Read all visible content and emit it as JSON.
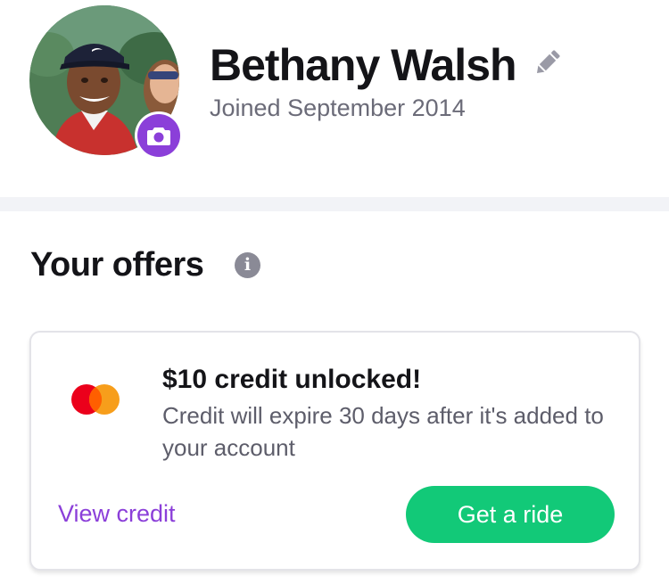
{
  "profile": {
    "name": "Bethany Walsh",
    "joined": "Joined September 2014",
    "avatar_icon": "profile-photo",
    "camera_icon": "camera-icon",
    "edit_icon": "pencil-icon"
  },
  "offers": {
    "title": "Your offers",
    "info_icon": "info-icon",
    "info_glyph": "i",
    "card": {
      "payment_icon": "mastercard-logo",
      "title": "$10 credit unlocked!",
      "description": "Credit will expire 30 days after it's added to your account",
      "view_credit_label": "View credit",
      "ride_button_label": "Get a ride"
    }
  },
  "colors": {
    "accent_purple": "#8b3fd9",
    "ride_green": "#12c978",
    "divider_gray": "#f2f3f7",
    "mastercard_red": "#eb001b",
    "mastercard_orange": "#f79e1b"
  }
}
